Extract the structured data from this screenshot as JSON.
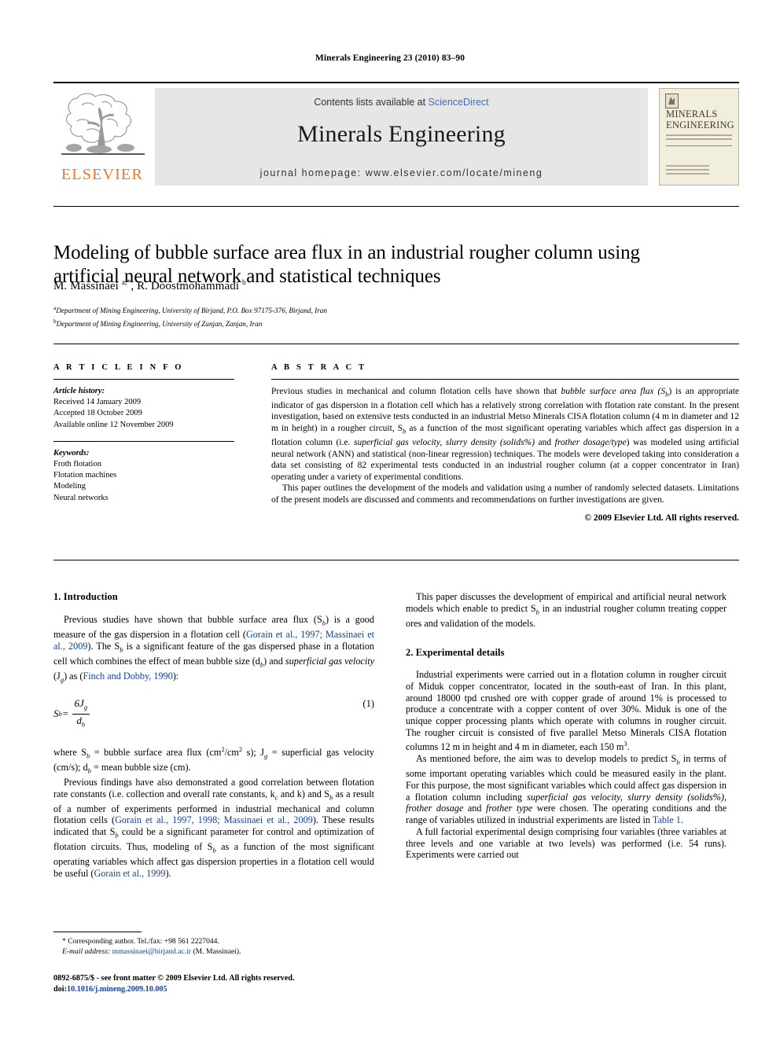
{
  "running_head": "Minerals Engineering 23 (2010) 83–90",
  "masthead": {
    "contents_prefix": "Contents lists available at ",
    "sciencedirect": "ScienceDirect",
    "journal_title": "Minerals Engineering",
    "homepage": "journal homepage: www.elsevier.com/locate/mineng",
    "publisher_logo_text": "ELSEVIER",
    "cover_title_line1": "MINERALS",
    "cover_title_line2": "ENGINEERING",
    "link_color": "#3b6ec9",
    "logo_color": "#e87722",
    "masthead_bg": "#e6e6e6"
  },
  "article": {
    "title": "Modeling of bubble surface area flux in an industrial rougher column using artificial neural network and statistical techniques",
    "authors_html": "M. Massinaei <sup>a,*</sup>, R. Doostmohammadi <sup>b</sup>",
    "affiliation_a": "Department of Mining Engineering, University of Birjand, P.O. Box 97175-376, Birjand, Iran",
    "affiliation_b": "Department of Mining Engineering, University of Zanjan, Zanjan, Iran"
  },
  "info": {
    "heading": "A R T I C L E   I N F O",
    "history_label": "Article history:",
    "history": [
      "Received 14 January 2009",
      "Accepted 18 October 2009",
      "Available online 12 November 2009"
    ],
    "keywords_label": "Keywords:",
    "keywords": [
      "Froth flotation",
      "Flotation machines",
      "Modeling",
      "Neural networks"
    ]
  },
  "abstract": {
    "heading": "A B S T R A C T",
    "para1_a": "Previous studies in mechanical and column flotation cells have shown that ",
    "para1_ital1": "bubble surface area flux (S",
    "para1_ital1_sub": "b",
    "para1_b": ") is an appropriate indicator of gas dispersion in a flotation cell which has a relatively strong correlation with flotation rate constant. In the present investigation, based on extensive tests conducted in an industrial Metso Minerals CISA flotation column (4 m in diameter and 12 m in height) in a rougher circuit, S",
    "para1_c": " as a function of the most significant operating variables which affect gas dispersion in a flotation column (i.e. ",
    "para1_ital2": "superficial gas velocity, slurry density (solids%)",
    "para1_d": " and ",
    "para1_ital3": "frother dosage/type",
    "para1_e": ") was modeled using artificial neural network (ANN) and statistical (non-linear regression) techniques. The models were developed taking into consideration a data set consisting of 82 experimental tests conducted in an industrial rougher column (at a copper concentrator in Iran) operating under a variety of experimental conditions.",
    "para2": "This paper outlines the development of the models and validation using a number of randomly selected datasets. Limitations of the present models are discussed and comments and recommendations on further investigations are given.",
    "copyright": "© 2009 Elsevier Ltd. All rights reserved."
  },
  "body": {
    "section1_heading": "1. Introduction",
    "s1p1_a": "Previous studies have shown that bubble surface area flux (S",
    "s1p1_b": ") is a good measure of the gas dispersion in a flotation cell (",
    "s1p1_cite1": "Gorain et al., 1997; Massinaei et al., 2009",
    "s1p1_c": "). The S",
    "s1p1_d": " is a significant feature of the gas dispersed phase in a flotation cell which combines the effect of mean bubble size (d",
    "s1p1_e": ") and ",
    "s1p1_ital": "superficial gas velocity",
    "s1p1_f": " (J",
    "s1p1_g": ") as (",
    "s1p1_cite2": "Finch and Dobby, 1990",
    "s1p1_h": "):",
    "equation": {
      "lhs": "S",
      "lhs_sub": "b",
      "equals": " = ",
      "numerator": "6J",
      "numerator_sub": "g",
      "denominator": "d",
      "denominator_sub": "b",
      "number": "(1)"
    },
    "s1p2_a": "where S",
    "s1p2_b": " = bubble surface area flux (cm",
    "s1p2_sup1": "2",
    "s1p2_c": "/cm",
    "s1p2_sup2": "2",
    "s1p2_d": " s); J",
    "s1p2_e": " = superficial gas velocity (cm/s); d",
    "s1p2_f": " = mean bubble size (cm).",
    "s1p3_a": "Previous findings have also demonstrated a good correlation between flotation rate constants (i.e. collection and overall rate constants, k",
    "s1p3_b": " and k) and S",
    "s1p3_c": " as a result of a number of experiments performed in industrial mechanical and column flotation cells (",
    "s1p3_cite1": "Gorain et al., 1997, 1998; Massinaei et al., 2009",
    "s1p3_d": "). These results indicated that S",
    "s1p3_e": " could be a significant parameter for control and optimization of flotation circuits. Thus, modeling of S",
    "s1p3_f": " as a function of the most significant operating variables which affect gas dispersion properties in a flotation cell would be useful (",
    "s1p3_cite2": "Gorain et al., 1999",
    "s1p3_g": ").",
    "rp1_a": "This paper discusses the development of empirical and artificial neural network models which enable to predict S",
    "rp1_b": " in an industrial rougher column treating copper ores and validation of the models.",
    "section2_heading": "2. Experimental details",
    "s2p1": "Industrial experiments were carried out in a flotation column in rougher circuit of Miduk copper concentrator, located in the south-east of Iran. In this plant, around 18000 tpd crushed ore with copper grade of around 1% is processed to produce a concentrate with a copper content of over 30%. Miduk is one of the unique copper processing plants which operate with columns in rougher circuit. The rougher circuit is consisted of five parallel Metso Minerals CISA flotation columns 12 m in height and 4 m in diameter, each 150 m",
    "s2p1_sup": "3",
    "s2p1_end": ".",
    "s2p2_a": "As mentioned before, the aim was to develop models to predict S",
    "s2p2_b": " in terms of some important operating variables which could be measured easily in the plant. For this purpose, the most significant variables which could affect gas dispersion in a flotation column including ",
    "s2p2_ital1": "superficial gas velocity, slurry density (solids%), frother dosage",
    "s2p2_c": " and ",
    "s2p2_ital2": "frother type",
    "s2p2_d": " were chosen. The operating conditions and the range of variables utilized in industrial experiments are listed in ",
    "s2p2_ref": "Table 1",
    "s2p2_e": ".",
    "s2p3": "A full factorial experimental design comprising four variables (three variables at three levels and one variable at two levels) was performed (i.e. 54 runs). Experiments were carried out"
  },
  "footnote": {
    "corresponding": "* Corresponding author. Tel./fax: +98 561 2227044.",
    "email_label": "E-mail address:",
    "email": "mmassinaei@birjand.ac.ir",
    "email_suffix": " (M. Massinaei)."
  },
  "imprint": {
    "line1": "0892-6875/$ - see front matter © 2009 Elsevier Ltd. All rights reserved.",
    "doi_label": "doi:",
    "doi": "10.1016/j.mineng.2009.10.005"
  }
}
